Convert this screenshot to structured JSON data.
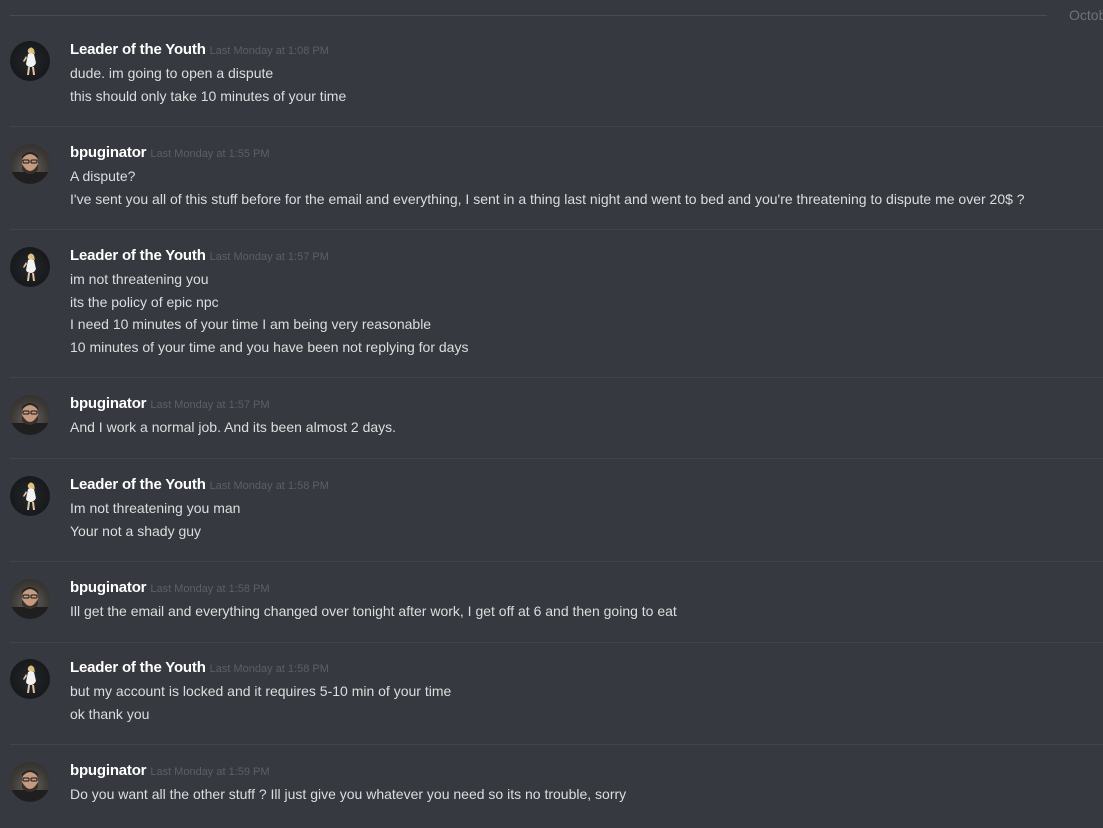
{
  "date_divider": "Octobe",
  "messages": [
    {
      "author": "Leader of the Youth",
      "avatar": "leader-avatar",
      "timestamp": "Last Monday at 1:08 PM",
      "lines": [
        "dude. im going to open a dispute",
        "this should only take 10 minutes of your time"
      ]
    },
    {
      "author": "bpuginator",
      "avatar": "bpuginator-avatar",
      "timestamp": "Last Monday at 1:55 PM",
      "lines": [
        "A dispute?",
        "I've sent you all of this stuff before for the email and everything, I sent in a thing last night and went to bed and you're threatening to dispute me over 20$ ?"
      ]
    },
    {
      "author": "Leader of the Youth",
      "avatar": "leader-avatar",
      "timestamp": "Last Monday at 1:57 PM",
      "lines": [
        "im not threatening you",
        "its the policy of epic npc",
        "I need 10 minutes of your time I am being  very reasonable",
        "10 minutes of your time and you have been not replying for days"
      ]
    },
    {
      "author": "bpuginator",
      "avatar": "bpuginator-avatar",
      "timestamp": "Last Monday at 1:57 PM",
      "lines": [
        "And I work a normal job. And its been almost 2 days."
      ]
    },
    {
      "author": "Leader of the Youth",
      "avatar": "leader-avatar",
      "timestamp": "Last Monday at 1:58 PM",
      "lines": [
        "Im not threatening you man",
        "Your not a shady guy"
      ]
    },
    {
      "author": "bpuginator",
      "avatar": "bpuginator-avatar",
      "timestamp": "Last Monday at 1:58 PM",
      "lines": [
        "Ill get the email and everything changed over tonight after work, I get off at 6 and then going to eat"
      ]
    },
    {
      "author": "Leader of the Youth",
      "avatar": "leader-avatar",
      "timestamp": "Last Monday at 1:58 PM",
      "lines": [
        "but my account is locked and it requires 5-10 min of your time",
        "ok thank you"
      ]
    },
    {
      "author": "bpuginator",
      "avatar": "bpuginator-avatar",
      "timestamp": "Last Monday at 1:59 PM",
      "lines": [
        "Do you want all the other stuff ? Ill just give you whatever you need so its no trouble, sorry"
      ]
    }
  ]
}
